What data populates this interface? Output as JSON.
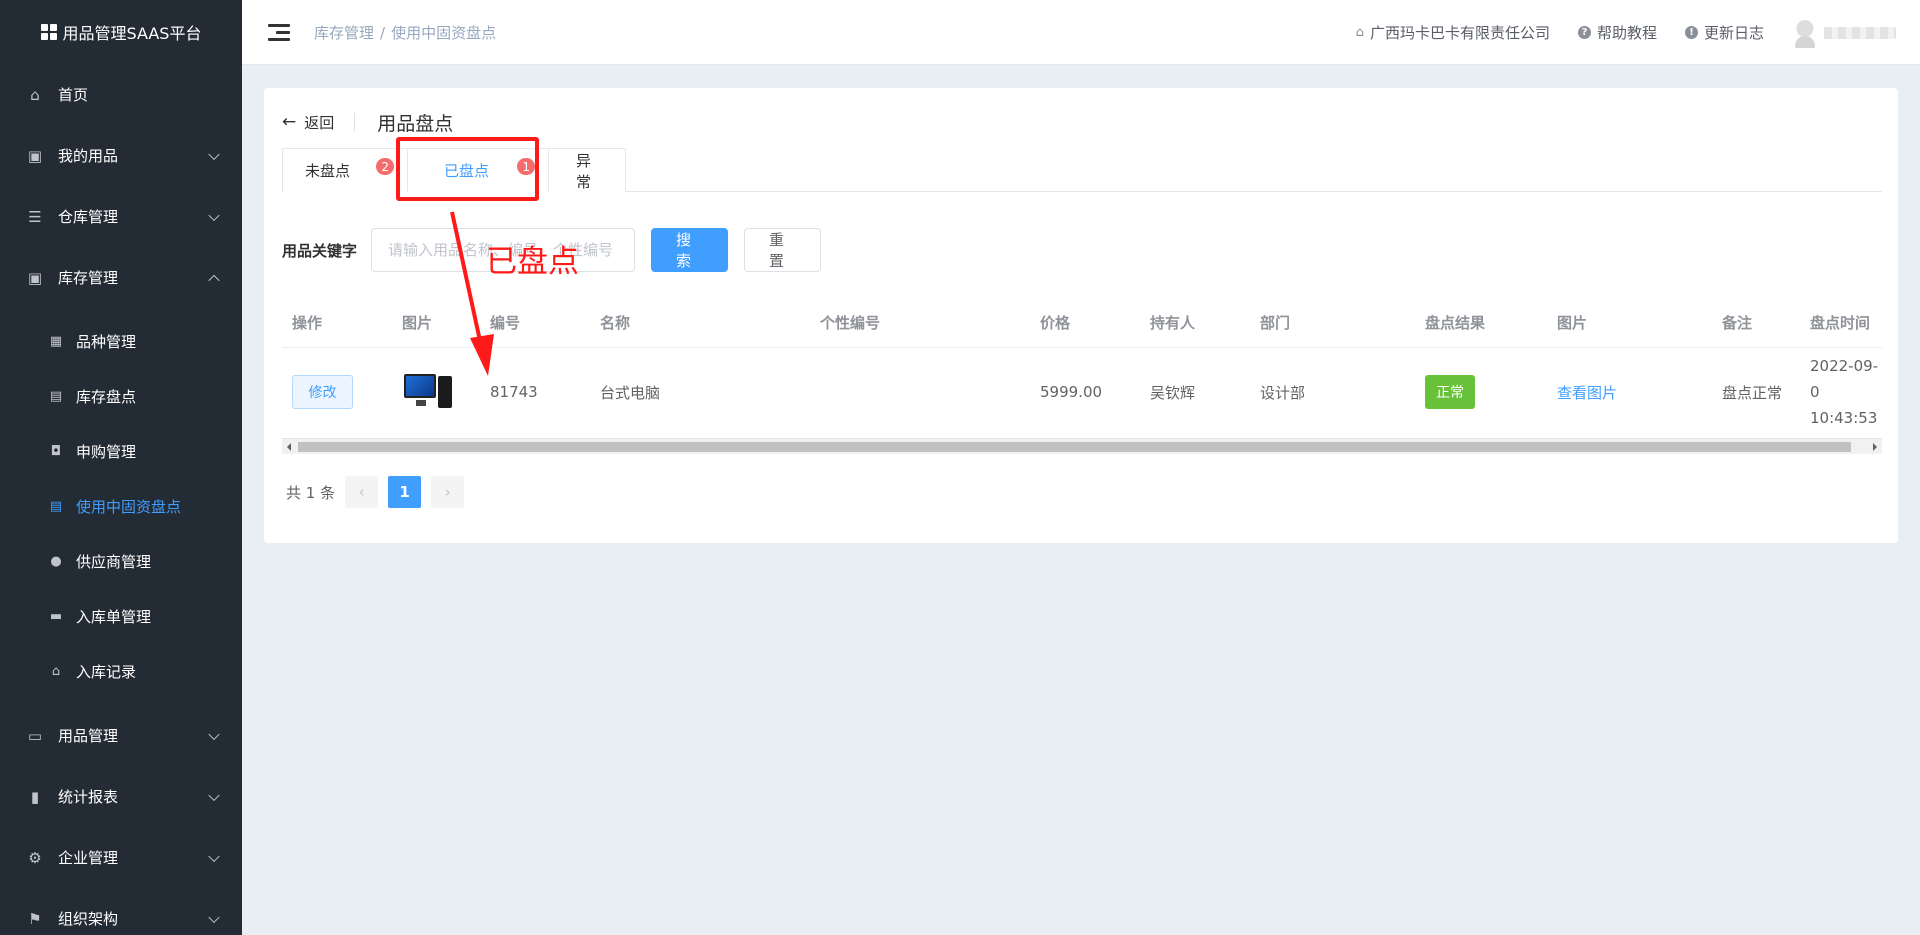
{
  "app": {
    "title": "用品管理SAAS平台"
  },
  "sidebar": {
    "items": [
      {
        "label": "首页"
      },
      {
        "label": "我的用品"
      },
      {
        "label": "仓库管理"
      },
      {
        "label": "库存管理"
      },
      {
        "label": "用品管理"
      },
      {
        "label": "统计报表"
      },
      {
        "label": "企业管理"
      },
      {
        "label": "组织架构"
      }
    ],
    "submenu": [
      {
        "label": "品种管理"
      },
      {
        "label": "库存盘点"
      },
      {
        "label": "申购管理"
      },
      {
        "label": "使用中固资盘点"
      },
      {
        "label": "供应商管理"
      },
      {
        "label": "入库单管理"
      },
      {
        "label": "入库记录"
      }
    ]
  },
  "header": {
    "breadcrumb": [
      "库存管理",
      "使用中固资盘点"
    ],
    "separator": "/",
    "company": "广西玛卡巴卡有限责任公司",
    "help": "帮助教程",
    "changelog": "更新日志"
  },
  "page": {
    "back_label": "返回",
    "title": "用品盘点",
    "tabs": [
      {
        "label": "未盘点",
        "badge": "2"
      },
      {
        "label": "已盘点",
        "badge": "1"
      },
      {
        "label": "异常"
      }
    ],
    "search": {
      "label": "用品关键字",
      "placeholder": "请输入用品名称、编号、个性编号",
      "search_button": "搜索",
      "reset_button": "重置"
    },
    "table": {
      "headers": [
        "操作",
        "图片",
        "编号",
        "名称",
        "个性编号",
        "价格",
        "持有人",
        "部门",
        "盘点结果",
        "图片",
        "备注",
        "盘点时间"
      ],
      "rows": [
        {
          "action": "修改",
          "code": "81743",
          "name": "台式电脑",
          "custom_code": "",
          "price": "5999.00",
          "holder": "吴钦辉",
          "department": "设计部",
          "result": "正常",
          "image_link": "查看图片",
          "remark": "盘点正常",
          "time_date": "2022-09-0",
          "time_clock": "10:43:53"
        }
      ]
    },
    "pagination": {
      "total": "共 1 条",
      "current": "1"
    }
  },
  "annotation": {
    "text": "已盘点",
    "color": "#ff1a1a"
  },
  "colors": {
    "primary": "#409eff",
    "success": "#67c23a",
    "danger": "#f56c6c",
    "sidebar": "#232b35"
  }
}
